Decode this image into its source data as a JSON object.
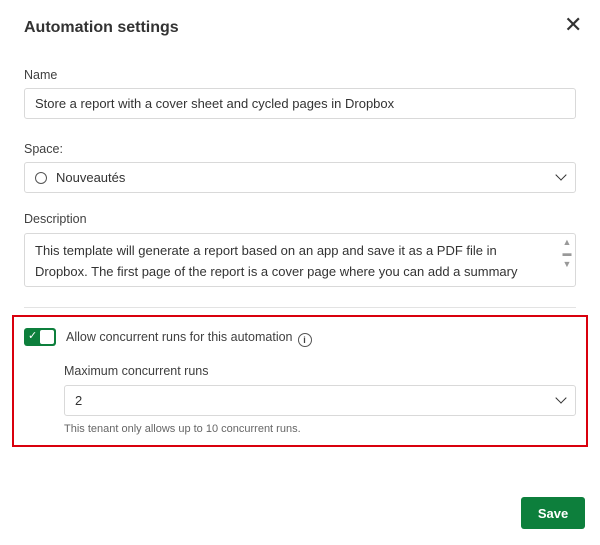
{
  "dialog": {
    "title": "Automation settings",
    "close_icon": "close-icon"
  },
  "name": {
    "label": "Name",
    "value": "Store a report with a cover sheet and cycled pages in Dropbox"
  },
  "space": {
    "label": "Space:",
    "value": "Nouveautés",
    "icon": "space-icon"
  },
  "description": {
    "label": "Description",
    "value": "This template will generate a report based on an app and save it as a PDF file in Dropbox. The first page of the report is a cover page where you can add a summary sheet. The next pages will show the same sheet but with a different selection applied to each page."
  },
  "concurrency": {
    "toggle_on": true,
    "toggle_label": "Allow concurrent runs for this automation",
    "max_label": "Maximum concurrent runs",
    "max_value": "2",
    "hint": "This tenant only allows up to 10 concurrent runs."
  },
  "footer": {
    "save_label": "Save"
  },
  "colors": {
    "accent": "#0d7f3c",
    "highlight": "#d9000d"
  }
}
